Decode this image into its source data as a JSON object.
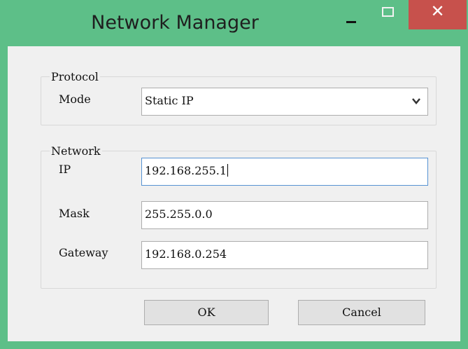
{
  "window": {
    "title": "Network Manager",
    "controls": {
      "minimize": "–",
      "maximize": "□",
      "close": "✕"
    },
    "accent_color": "#5dbf88",
    "close_color": "#c7514c"
  },
  "protocol": {
    "legend": "Protocol",
    "mode_label": "Mode",
    "mode_value": "Static IP"
  },
  "network": {
    "legend": "Network",
    "ip_label": "IP",
    "ip_value": "192.168.255.1",
    "mask_label": "Mask",
    "mask_value": "255.255.0.0",
    "gateway_label": "Gateway",
    "gateway_value": "192.168.0.254"
  },
  "buttons": {
    "ok": "OK",
    "cancel": "Cancel"
  },
  "icons": {
    "minimize": "minimize-icon",
    "maximize": "maximize-icon",
    "close": "close-icon",
    "dropdown": "chevron-down-icon"
  }
}
